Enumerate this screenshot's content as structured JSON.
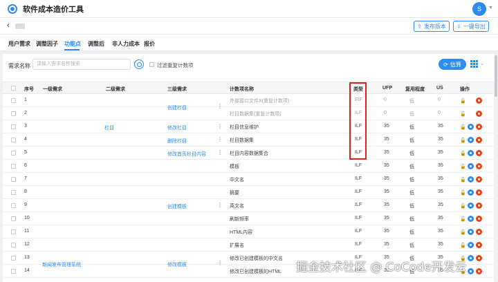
{
  "app": {
    "title": "软件成本造价工具",
    "user_initials": "S"
  },
  "subheader": {
    "publish_label": "发布版本",
    "export_label": "一键导出"
  },
  "tabs": [
    "用户需求",
    "调整因子",
    "功能点",
    "调整后",
    "非人力成本",
    "报价"
  ],
  "active_tab": "功能点",
  "search": {
    "label": "需求名称",
    "placeholder": "请输入需求名称搜索",
    "filter_label": "过滤重复计数项",
    "estimate_label": "估算"
  },
  "columns": [
    "序号",
    "一级需求",
    "二级需求",
    "三级需求",
    "计数项名称",
    "类型",
    "UFP",
    "复用程度",
    "US",
    "操作"
  ],
  "rows": [
    {
      "no": "1",
      "name": "外部接口文件X(重复计数项)",
      "type": "EIF",
      "ufp": "0",
      "reuse": "低",
      "us": "0",
      "muted": true
    },
    {
      "no": "2",
      "name": "栏目数据集(重复计数项)",
      "type": "ILF",
      "ufp": "0",
      "reuse": "低",
      "us": "0",
      "muted": true
    },
    {
      "no": "3",
      "name": "栏目信息维护",
      "type": "ILF",
      "ufp": "35",
      "reuse": "低",
      "us": "35",
      "muted": false
    },
    {
      "no": "4",
      "name": "栏目数据集",
      "type": "ILF",
      "ufp": "35",
      "reuse": "低",
      "us": "35",
      "muted": false
    },
    {
      "no": "5",
      "name": "栏目内容数据集合",
      "type": "ILF",
      "ufp": "35",
      "reuse": "低",
      "us": "35",
      "muted": false
    },
    {
      "no": "6",
      "name": "模板",
      "type": "ILF",
      "ufp": "35",
      "reuse": "低",
      "us": "35",
      "muted": false
    },
    {
      "no": "7",
      "name": "中文名",
      "type": "ILF",
      "ufp": "35",
      "reuse": "低",
      "us": "35",
      "muted": false
    },
    {
      "no": "8",
      "name": "摘要",
      "type": "ILF",
      "ufp": "35",
      "reuse": "低",
      "us": "35",
      "muted": false
    },
    {
      "no": "9",
      "name": "英文名",
      "type": "ILF",
      "ufp": "35",
      "reuse": "低",
      "us": "35",
      "muted": false
    },
    {
      "no": "10",
      "name": "刷新频率",
      "type": "ILF",
      "ufp": "35",
      "reuse": "低",
      "us": "35",
      "muted": false
    },
    {
      "no": "11",
      "name": "HTML内容",
      "type": "ILF",
      "ufp": "35",
      "reuse": "低",
      "us": "35",
      "muted": false
    },
    {
      "no": "12",
      "name": "扩展名",
      "type": "ILF",
      "ufp": "35",
      "reuse": "低",
      "us": "35",
      "muted": false
    },
    {
      "no": "13",
      "name": "修改已创建模板的中文名",
      "type": "ILF",
      "ufp": "35",
      "reuse": "低",
      "us": "35",
      "muted": false
    },
    {
      "no": "14",
      "name": "修改已创建模板的HTML",
      "type": "ILF",
      "ufp": "35",
      "reuse": "低",
      "us": "35",
      "muted": false
    }
  ],
  "level1": {
    "news_system": "新闻发布管理系统"
  },
  "level2": {
    "column": "栏目"
  },
  "level3": {
    "create_column": "创建栏目",
    "edit_column": "修改栏目",
    "delete_column": "删除栏目",
    "edit_home_content": "修改首页栏目内容",
    "create_template": "创建模板",
    "edit_template": "修改模板"
  },
  "watermark": "掘金技术社区 @ CoCode开发云"
}
